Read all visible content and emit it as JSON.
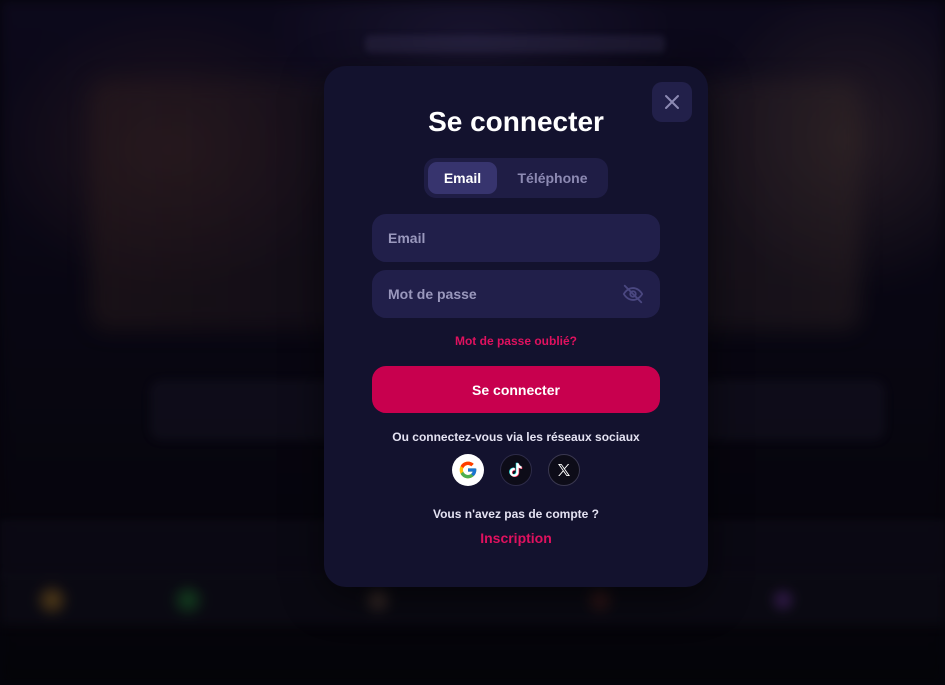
{
  "modal": {
    "title": "Se connecter",
    "close_icon": "close-icon",
    "tabs": [
      {
        "label": "Email",
        "active": true
      },
      {
        "label": "Téléphone",
        "active": false
      }
    ],
    "email_field": {
      "placeholder": "Email",
      "value": ""
    },
    "password_field": {
      "placeholder": "Mot de passe",
      "value": "",
      "toggle_icon": "eye-off-icon"
    },
    "forgot_password": "Mot de passe oublié?",
    "submit_label": "Se connecter",
    "social_text": "Ou connectez-vous via les réseaux sociaux",
    "social_icons": [
      "google-icon",
      "tiktok-icon",
      "x-icon"
    ],
    "no_account_text": "Vous n'avez pas de compte ?",
    "signup_label": "Inscription"
  },
  "colors": {
    "modal_bg": "#13122e",
    "input_bg": "#211f4a",
    "tab_active_bg": "#37346e",
    "accent": "#c8004e",
    "link": "#e0115f"
  }
}
